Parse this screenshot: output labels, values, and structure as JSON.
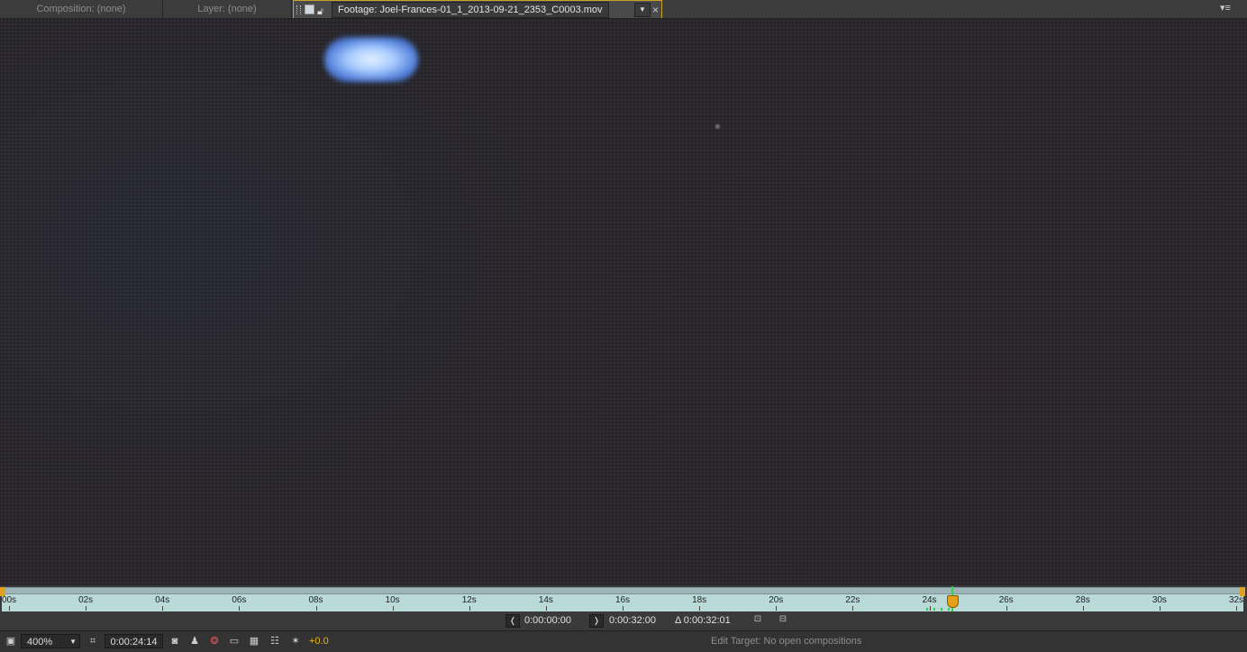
{
  "tabs": {
    "composition": "Composition: (none)",
    "layer": "Layer: (none)",
    "footage": "Footage: Joel-Frances-01_1_2013-09-21_2353_C0003.mov"
  },
  "ruler": {
    "ticks": [
      "00s",
      "02s",
      "04s",
      "06s",
      "08s",
      "10s",
      "12s",
      "14s",
      "16s",
      "18s",
      "20s",
      "22s",
      "24s",
      "26s",
      "28s",
      "30s",
      "32s"
    ]
  },
  "transport": {
    "in_point": "0:00:00:00",
    "out_point": "0:00:32:00",
    "duration": "Δ 0:00:32:01"
  },
  "toolbar": {
    "zoom": "400%",
    "current_time": "0:00:24:14",
    "exposure": "+0.0",
    "edit_target": "Edit Target: No open compositions"
  },
  "accent_colors": {
    "active_tab_border": "#c9a227",
    "cti_head": "#e8a018",
    "cti_line": "#2fd44a",
    "ruler": "#b9dad9"
  },
  "icons": [
    "grip-icon",
    "lock-icon",
    "dropdown-caret-icon",
    "close-icon",
    "panel-menu-icon",
    "set-in-icon",
    "set-out-icon",
    "camera-icon",
    "person-icon",
    "color-channels-icon",
    "region-of-interest-icon",
    "transparency-grid-icon",
    "guides-icon",
    "exposure-icon",
    "snapshot-icon",
    "resolution-icon"
  ]
}
